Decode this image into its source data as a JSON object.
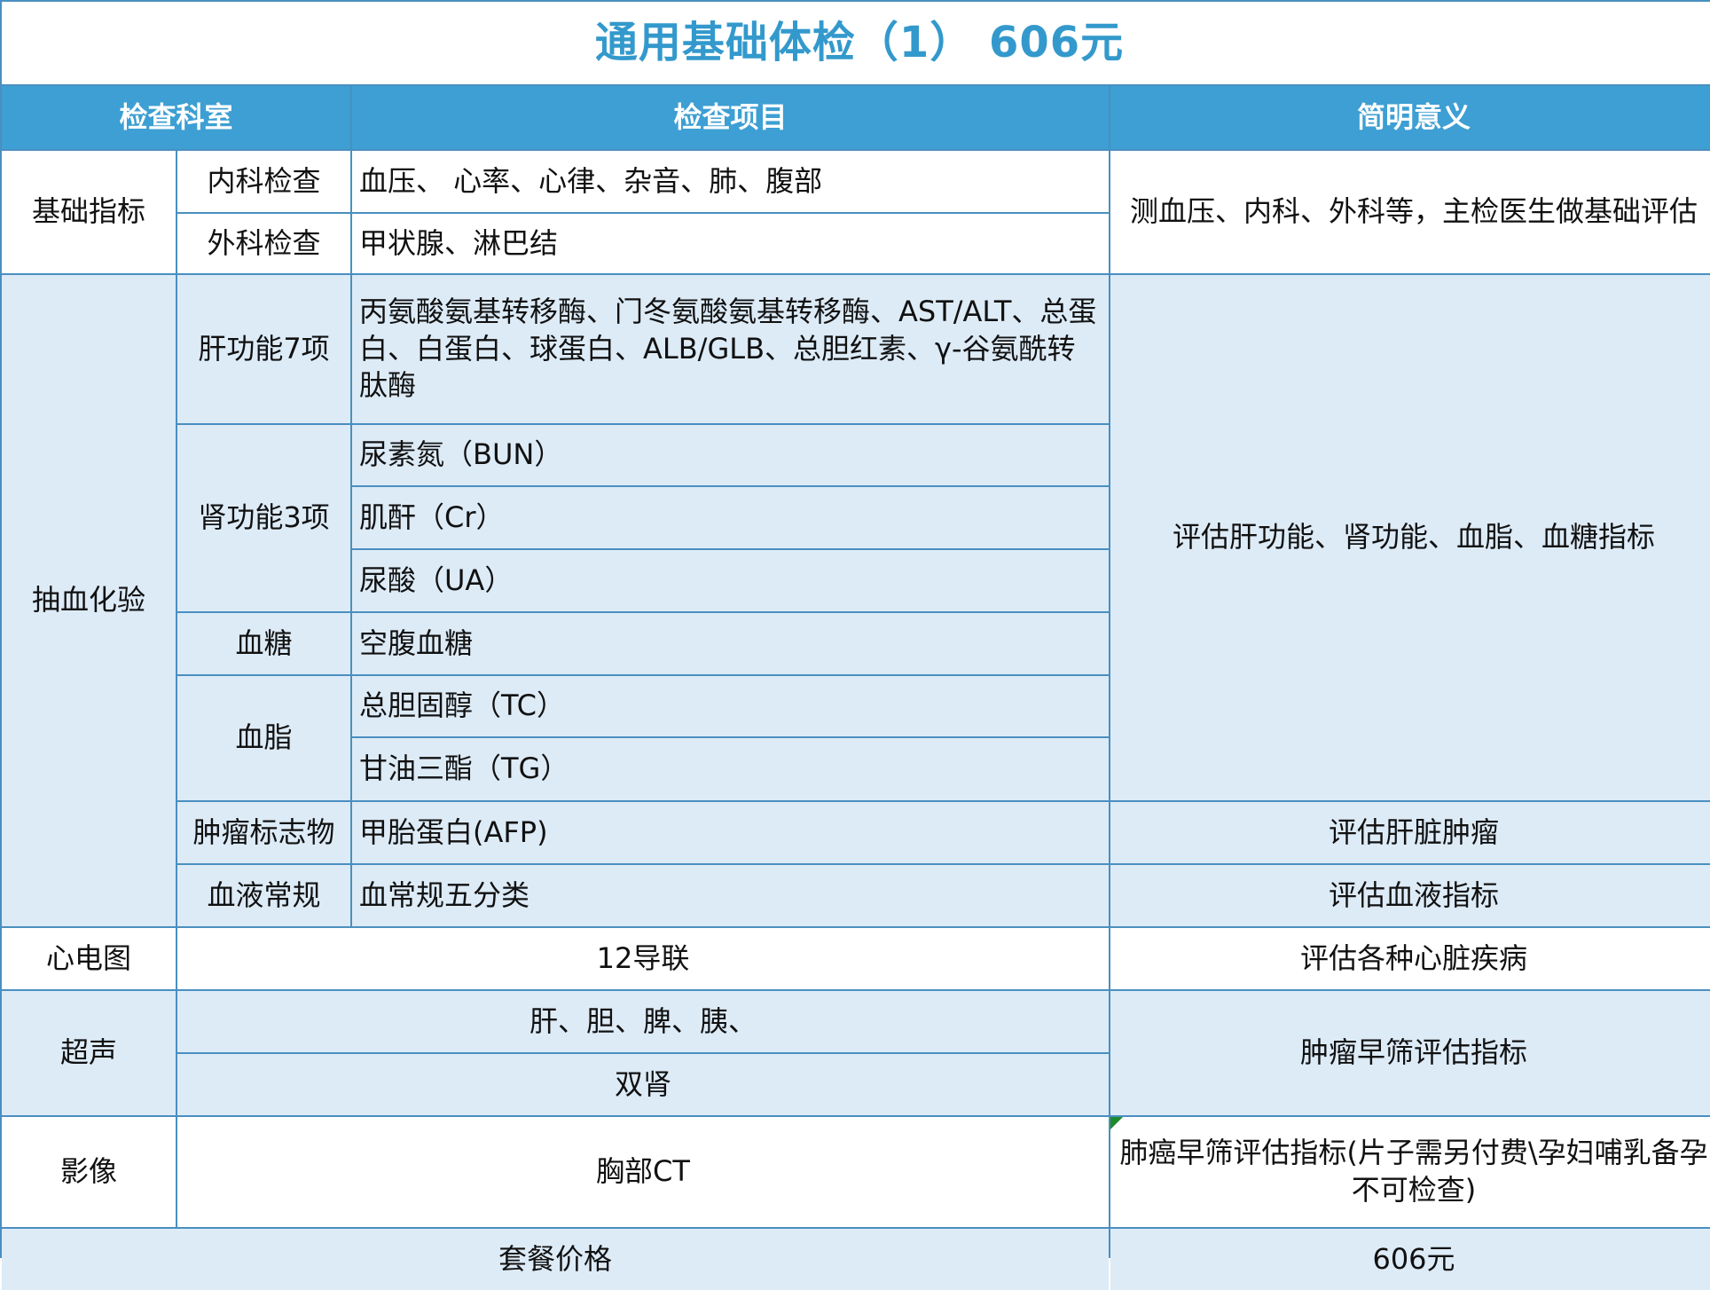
{
  "title": "通用基础体检（1） 606元",
  "header": {
    "dept": "检查科室",
    "item": "检查项目",
    "meaning": "简明意义"
  },
  "basic": {
    "group": "基础指标",
    "sub1": "内科检查",
    "item1": "血压、 心率、心律、杂音、肺、腹部",
    "sub2": "外科检查",
    "item2": "甲状腺、淋巴结",
    "meaning": "测血压、内科、外科等，主检医生做基础评估"
  },
  "blood": {
    "group": "抽血化验",
    "liver_label": "肝功能7项",
    "liver_item": "丙氨酸氨基转移酶、门冬氨酸氨基转移酶、AST/ALT、总蛋白、白蛋白、球蛋白、ALB/GLB、总胆红素、γ-谷氨酰转肽酶",
    "kidney_label": "肾功能3项",
    "kidney_items": [
      "尿素氮（BUN）",
      "肌酐（Cr）",
      "尿酸（UA）"
    ],
    "sugar_label": "血糖",
    "sugar_item": "空腹血糖",
    "lipid_label": "血脂",
    "lipid_items": [
      "总胆固醇（TC）",
      "甘油三酯（TG）"
    ],
    "meaning": "评估肝功能、肾功能、血脂、血糖指标",
    "tumor_label": "肿瘤标志物",
    "tumor_item": "甲胎蛋白(AFP)",
    "tumor_meaning": "评估肝脏肿瘤",
    "routine_label": "血液常规",
    "routine_item": "血常规五分类",
    "routine_meaning": "评估血液指标"
  },
  "ecg": {
    "label": "心电图",
    "item": "12导联",
    "meaning": "评估各种心脏疾病"
  },
  "ultrasound": {
    "label": "超声",
    "items": [
      "肝、胆、脾、胰、",
      "双肾"
    ],
    "meaning": "肿瘤早筛评估指标"
  },
  "imaging": {
    "label": "影像",
    "item": "胸部CT",
    "meaning": "肺癌早筛评估指标(片子需另付费\\孕妇哺乳备孕不可检查)"
  },
  "price": {
    "label": "套餐价格",
    "value": "606元"
  },
  "colors": {
    "header_bg": "#3d9fd3",
    "title_text": "#3399cc",
    "band_bg": "#ddebf7",
    "grid_line": "#4a8fc0"
  }
}
